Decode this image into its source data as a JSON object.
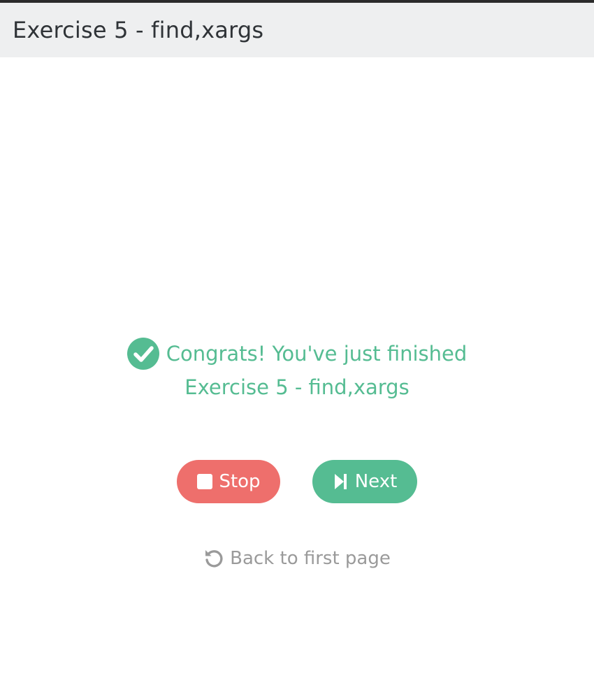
{
  "header": {
    "title": "Exercise 5 - find,xargs"
  },
  "congrats": {
    "icon": "check-circle-icon",
    "line1": "Congrats! You've just finished",
    "line2": "Exercise 5 - find,xargs"
  },
  "actions": {
    "stop_label": "Stop",
    "stop_icon": "stop-icon",
    "next_label": "Next",
    "next_icon": "step-forward-icon"
  },
  "back": {
    "label": "Back to first page",
    "icon": "undo-icon"
  },
  "colors": {
    "accent_green": "#55bc92",
    "stop_red": "#ee6f6c",
    "muted_gray": "#9a9a9a",
    "header_bg": "#eeeff0"
  }
}
